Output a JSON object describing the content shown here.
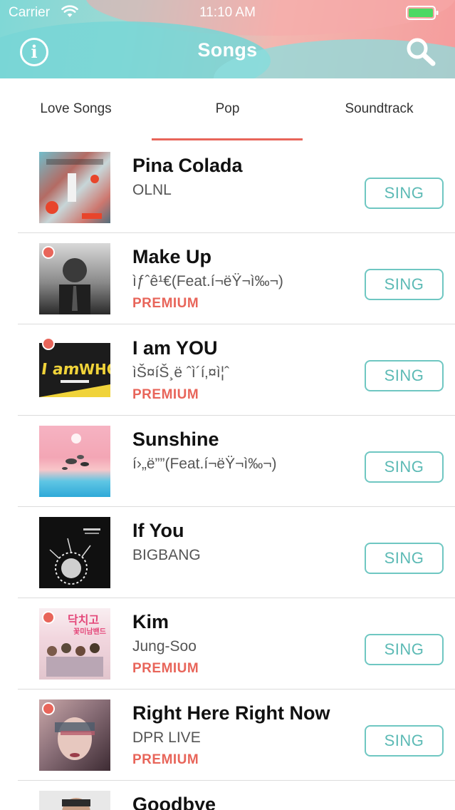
{
  "status_bar": {
    "carrier": "Carrier",
    "time": "11:10 AM"
  },
  "header": {
    "title": "Songs",
    "info_icon": "info-icon",
    "search_icon": "search-icon"
  },
  "tabs": [
    {
      "label": "Love Songs",
      "selected": false
    },
    {
      "label": "Pop",
      "selected": true
    },
    {
      "label": "Soundtrack",
      "selected": false
    }
  ],
  "accent_color": "#e8655a",
  "button_color": "#6fc7c2",
  "songs": [
    {
      "title": "Pina Colada",
      "artist": "OLNL",
      "premium": "",
      "button": "SING"
    },
    {
      "title": "Make Up",
      "artist": "ìƒˆê¹€(Feat.í¬ëŸ¬ì‰¬)",
      "premium": "PREMIUM",
      "button": "SING"
    },
    {
      "title": " I am YOU",
      "artist": "ìŠ¤íŠ¸ë ˆì´í‚¤ì¦ˆ",
      "premium": "PREMIUM",
      "button": "SING"
    },
    {
      "title": "Sunshine",
      "artist": "í›„ë””(Feat.í¬ëŸ¬ì‰¬)",
      "premium": "",
      "button": "SING"
    },
    {
      "title": "If You",
      "artist": "BIGBANG",
      "premium": "",
      "button": "SING"
    },
    {
      "title": "Kim",
      "artist": "Jung-Soo",
      "premium": "PREMIUM",
      "button": "SING"
    },
    {
      "title": "Right Here Right Now",
      "artist": "DPR LIVE",
      "premium": "PREMIUM",
      "button": "SING"
    },
    {
      "title": "Goodbye",
      "artist": "",
      "premium": "",
      "button": ""
    }
  ]
}
